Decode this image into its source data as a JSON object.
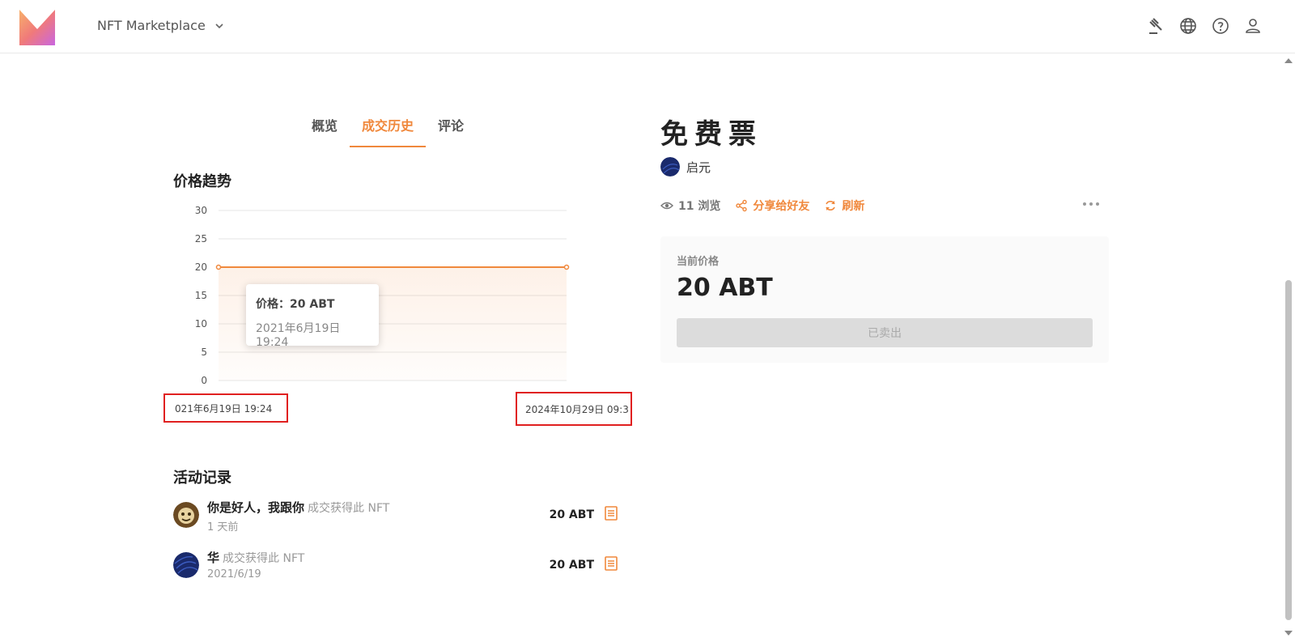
{
  "header": {
    "app_name": "NFT Marketplace",
    "icons": [
      "gavel-icon",
      "globe-icon",
      "help-icon",
      "user-icon"
    ]
  },
  "tabs": [
    {
      "label": "概览",
      "active": false
    },
    {
      "label": "成交历史",
      "active": true
    },
    {
      "label": "评论",
      "active": false
    }
  ],
  "price_trend": {
    "title": "价格趋势",
    "tooltip": {
      "price": "价格：20 ABT",
      "date": "2021年6月19日 19:24"
    },
    "x_start_label": "021年6月19日 19:24",
    "x_end_label": "2024年10月29日 09:3"
  },
  "chart_data": {
    "type": "area",
    "title": "价格趋势",
    "x": [
      "2021年6月19日 19:24",
      "2024年10月29日 09:3"
    ],
    "series": [
      {
        "values": [
          20,
          20
        ]
      }
    ],
    "yticks": [
      0,
      5,
      10,
      15,
      20,
      25,
      30
    ],
    "ylim": [
      0,
      30
    ],
    "grid": true,
    "color": "#f0883c"
  },
  "activity": {
    "title": "活动记录",
    "items": [
      {
        "name": "你是好人，我跟你",
        "desc": "成交获得此 NFT",
        "time": "1 天前",
        "price": "20 ABT"
      },
      {
        "name": "华",
        "desc": "成交获得此 NFT",
        "time": "2021/6/19",
        "price": "20 ABT"
      }
    ]
  },
  "nft": {
    "title": "免费票",
    "creator": "启元",
    "views": "11 浏览",
    "share": "分享给好友",
    "refresh": "刷新"
  },
  "price_card": {
    "label": "当前价格",
    "value": "20 ABT",
    "button": "已卖出"
  },
  "colors": {
    "accent": "#f0883c",
    "highlight_box": "#e02020"
  }
}
